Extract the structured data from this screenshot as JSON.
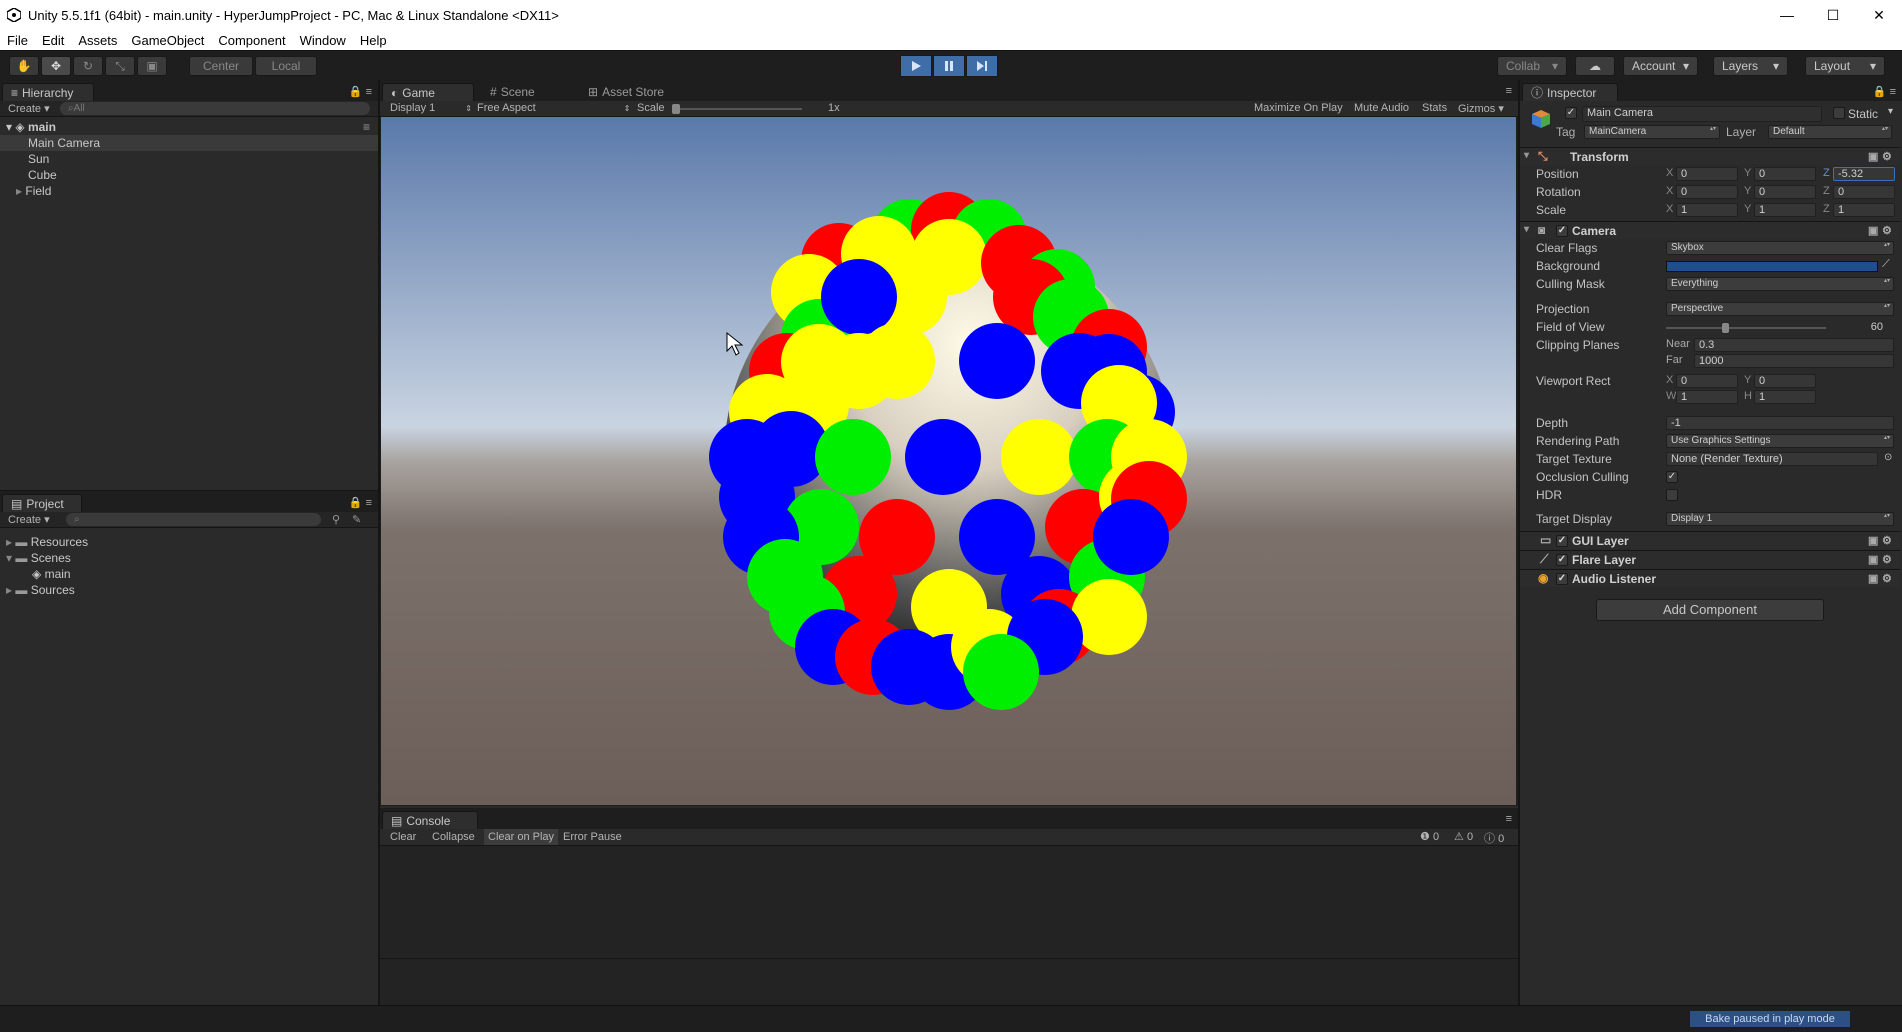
{
  "window": {
    "title": "Unity 5.5.1f1 (64bit) - main.unity - HyperJumpProject - PC, Mac & Linux Standalone <DX11>"
  },
  "menu": [
    "File",
    "Edit",
    "Assets",
    "GameObject",
    "Component",
    "Window",
    "Help"
  ],
  "toolbar": {
    "pivot": "Center",
    "space": "Local",
    "collab": "Collab",
    "account": "Account",
    "layers": "Layers",
    "layout": "Layout"
  },
  "hierarchy": {
    "tab": "Hierarchy",
    "create": "Create",
    "search": "All",
    "scene": "main",
    "items": [
      "Main Camera",
      "Sun",
      "Cube",
      "Field"
    ]
  },
  "project": {
    "tab": "Project",
    "create": "Create",
    "items": [
      "Resources",
      "Scenes",
      "main",
      "Sources"
    ]
  },
  "game": {
    "tabs": [
      "Game",
      "Scene",
      "Asset Store"
    ],
    "display": "Display 1",
    "aspect": "Free Aspect",
    "scale_label": "Scale",
    "scale_value": "1x",
    "maximize": "Maximize On Play",
    "mute": "Mute Audio",
    "stats": "Stats",
    "gizmos": "Gizmos"
  },
  "console": {
    "tab": "Console",
    "buttons": [
      "Clear",
      "Collapse",
      "Clear on Play",
      "Error Pause"
    ],
    "counts": [
      "0",
      "0",
      "0"
    ]
  },
  "inspector": {
    "tab": "Inspector",
    "object_name": "Main Camera",
    "static": "Static",
    "tag_label": "Tag",
    "tag": "MainCamera",
    "layer_label": "Layer",
    "layer": "Default",
    "transform": {
      "title": "Transform",
      "position_label": "Position",
      "pos": [
        "0",
        "0",
        "-5.32"
      ],
      "rotation_label": "Rotation",
      "rot": [
        "0",
        "0",
        "0"
      ],
      "scale_label": "Scale",
      "scale": [
        "1",
        "1",
        "1"
      ]
    },
    "camera": {
      "title": "Camera",
      "clear_flags_label": "Clear Flags",
      "clear_flags": "Skybox",
      "background_label": "Background",
      "culling_label": "Culling Mask",
      "culling": "Everything",
      "projection_label": "Projection",
      "projection": "Perspective",
      "fov_label": "Field of View",
      "fov": "60",
      "clipping_label": "Clipping Planes",
      "near_label": "Near",
      "near": "0.3",
      "far_label": "Far",
      "far": "1000",
      "viewport_label": "Viewport Rect",
      "vx": "0",
      "vy": "0",
      "vw": "1",
      "vh": "1",
      "depth_label": "Depth",
      "depth": "-1",
      "rendering_label": "Rendering Path",
      "rendering": "Use Graphics Settings",
      "target_texture_label": "Target Texture",
      "target_texture": "None (Render Texture)",
      "occlusion_label": "Occlusion Culling",
      "hdr_label": "HDR",
      "target_display_label": "Target Display",
      "target_display": "Display 1"
    },
    "components": [
      "GUI Layer",
      "Flare Layer",
      "Audio Listener"
    ],
    "add_component": "Add Component"
  },
  "status": {
    "bake": "Bake paused in play mode"
  },
  "colors": {
    "background_swatch": "#1f4e8f",
    "red": "#ff0000",
    "green": "#00ee00",
    "blue": "#0000ff",
    "yellow": "#ffff00"
  }
}
